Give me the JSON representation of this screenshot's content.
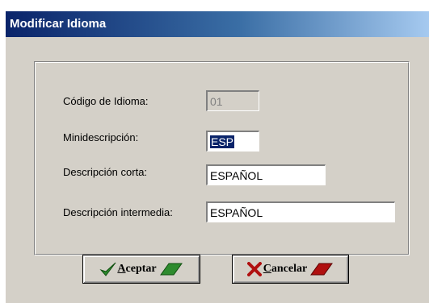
{
  "window": {
    "title": "Modificar Idioma"
  },
  "form": {
    "codigo": {
      "label": "Código de Idioma:",
      "value": "01"
    },
    "mini": {
      "label": "Minidescripción:",
      "value": "ESP"
    },
    "corta": {
      "label": "Descripción corta:",
      "value": "ESPAÑOL"
    },
    "intermedia": {
      "label": "Descripción intermedia:",
      "value": "ESPAÑOL"
    }
  },
  "buttons": {
    "aceptar": {
      "accel": "A",
      "rest": "ceptar",
      "icon": "checkmark-icon",
      "color": "#2e8b2e"
    },
    "cancelar": {
      "accel": "C",
      "rest": "ancelar",
      "icon": "x-icon",
      "color": "#b01010"
    }
  },
  "colors": {
    "title_start": "#0a246a",
    "title_end": "#a6caf0",
    "face": "#d4d0c8",
    "selection": "#0a246a"
  }
}
